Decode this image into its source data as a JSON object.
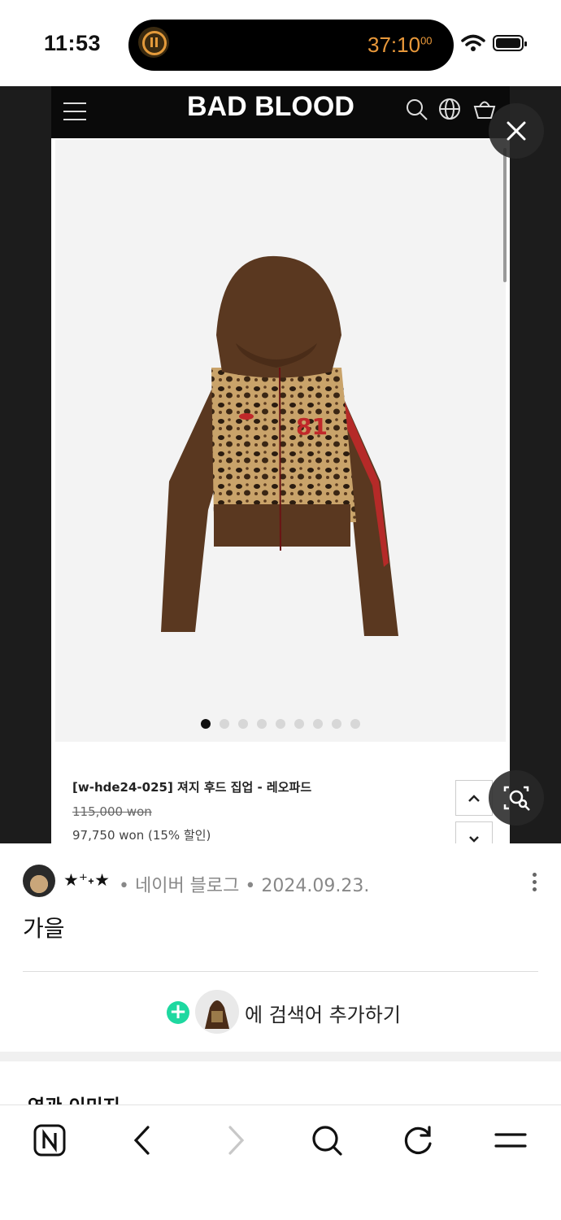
{
  "status_bar": {
    "time": "11:53",
    "timer_main": "37:10",
    "timer_fraction": "00",
    "timer_color": "#e8983a"
  },
  "viewer": {
    "site_logo": "BAD BLOOD",
    "product_name": "[w-hde24-025] 져지 후드 집업 - 레오파드",
    "original_price": "115,000 won",
    "sale_price": "97,750 won (15% 할인)",
    "carousel_total": 9,
    "carousel_active_index": 0
  },
  "result": {
    "author": "★⁺˖★",
    "source": "• 네이버 블로그 • 2024.09.23.",
    "caption": "가을",
    "add_search_text": "에 검색어 추가하기",
    "related_heading": "연관 이미지"
  },
  "icons": {
    "browser_nav": [
      "naver-n-icon",
      "back-icon",
      "forward-icon",
      "search-icon",
      "reload-icon",
      "menu-icon"
    ],
    "accent_green": "#1ed8a0"
  }
}
